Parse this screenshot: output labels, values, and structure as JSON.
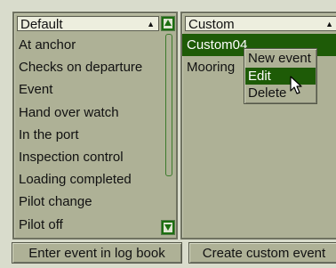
{
  "left_list": {
    "header": "Default",
    "sort_arrow": "▲",
    "items": [
      "At anchor",
      "Checks on departure",
      "Event",
      "Hand over watch",
      "In the port",
      "Inspection control",
      "Loading completed",
      "Pilot change",
      "Pilot off"
    ]
  },
  "right_list": {
    "header": "Custom",
    "sort_arrow": "▲",
    "items": [
      "Custom04",
      "Mooring"
    ],
    "selected_index": 0
  },
  "context_menu": {
    "items": [
      "New event",
      "Edit",
      "Delete"
    ],
    "highlighted_index": 1
  },
  "buttons": {
    "enter_event": "Enter event in log book",
    "create_custom": "Create custom event"
  },
  "colors": {
    "panel": "#aeb196",
    "selection": "#1e5b07",
    "scrollbar_accent": "#1c6e10"
  },
  "icons": {
    "cursor": "arrow-cursor-icon",
    "scroll_up": "triangle-up-icon",
    "scroll_down": "triangle-down-icon"
  }
}
